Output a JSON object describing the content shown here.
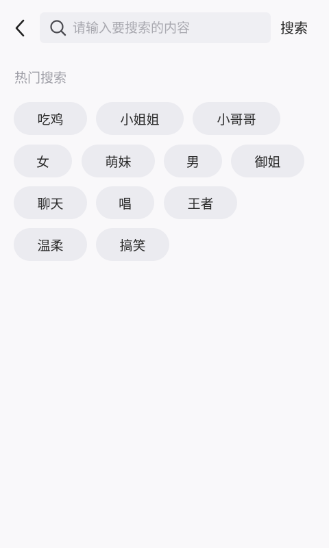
{
  "header": {
    "back_icon": "chevron-left-icon",
    "search_icon": "search-icon",
    "search_placeholder": "请输入要搜索的内容",
    "search_value": "",
    "search_button_label": "搜索"
  },
  "hot_search": {
    "title": "热门搜索",
    "tags": [
      "吃鸡",
      "小姐姐",
      "小哥哥",
      "女",
      "萌妹",
      "男",
      "御姐",
      "聊天",
      "唱",
      "王者",
      "温柔",
      "搞笑"
    ]
  },
  "colors": {
    "background": "#f9f8fa",
    "search_box": "#efeff3",
    "tag_background": "#ebebf0",
    "placeholder": "#a9a9b0",
    "section_title": "#9e9ea6"
  }
}
